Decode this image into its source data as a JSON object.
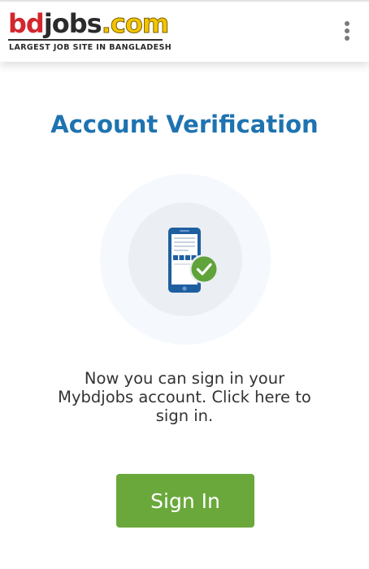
{
  "brand": {
    "logo_part1": "bd",
    "logo_part2": "jobs",
    "logo_part3": ".com",
    "tagline": "LARGEST JOB SITE IN BANGLADESH",
    "colors": {
      "bd": "#d3262d",
      "jobs": "#2b2b2b",
      "dotcom": "#f5c400"
    }
  },
  "header": {
    "menu_icon": "kebab-menu-icon"
  },
  "page": {
    "title": "Account Verification",
    "illustration_icon": "phone-verified-icon",
    "message": "Now you can sign in your Mybdjobs account. Click here to sign in.",
    "button_label": "Sign In"
  },
  "colors": {
    "title": "#1e73b0",
    "button": "#6aa83c",
    "check_badge": "#5fa33a",
    "phone": "#1f5fa0"
  }
}
